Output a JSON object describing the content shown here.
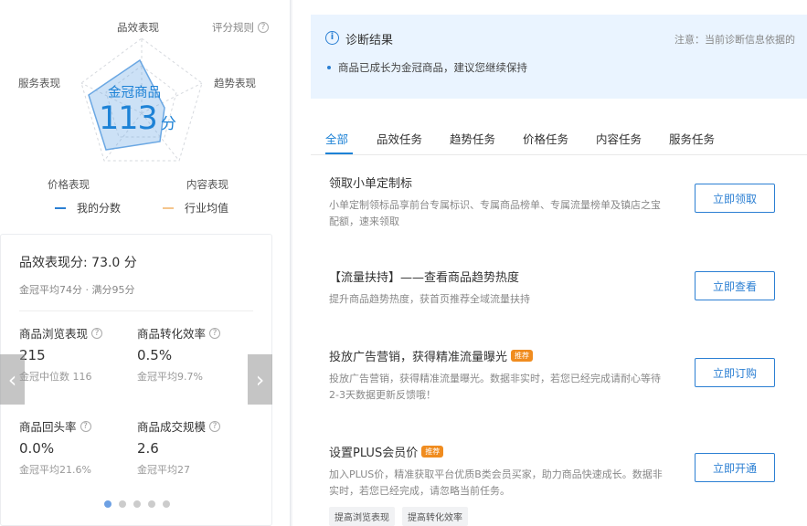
{
  "radar": {
    "axes": [
      "品效表现",
      "趋势表现",
      "内容表现",
      "价格表现",
      "服务表现"
    ],
    "score_rule": "评分规则",
    "center_title": "金冠商品",
    "score": "113",
    "score_unit": "分",
    "legend": [
      {
        "label": "我的分数",
        "color": "#2b7fd3"
      },
      {
        "label": "行业均值",
        "color": "#f5c58c"
      }
    ]
  },
  "perf_card": {
    "title": "品效表现分: 73.0 分",
    "subtitle": "金冠平均74分 · 满分95分",
    "metrics": [
      {
        "name": "商品浏览表现",
        "value": "215",
        "sub": "金冠中位数 116"
      },
      {
        "name": "商品转化效率",
        "value": "0.5%",
        "sub": "金冠平均9.7%"
      },
      {
        "name": "商品回头率",
        "value": "0.0%",
        "sub": "金冠平均21.6%"
      },
      {
        "name": "商品成交规模",
        "value": "2.6",
        "sub": "金冠平均27"
      }
    ],
    "prev_arrow": "‹",
    "next_arrow": "›"
  },
  "diagnosis": {
    "title": "诊断结果",
    "note": "注意：当前诊断信息依据的",
    "bullet": "商品已成长为金冠商品，建议您继续保持"
  },
  "tabs": [
    "全部",
    "品效任务",
    "趋势任务",
    "价格任务",
    "内容任务",
    "服务任务"
  ],
  "tasks": [
    {
      "title": "领取小单定制标",
      "badge": "",
      "desc": "小单定制领标品享前台专属标识、专属商品榜单、专属流量榜单及镇店之宝配额，速来领取",
      "button": "立即领取",
      "tags": []
    },
    {
      "title": "【流量扶持】——查看商品趋势热度",
      "badge": "",
      "desc": "提升商品趋势热度，获首页推荐全域流量扶持",
      "button": "立即查看",
      "tags": []
    },
    {
      "title": "投放广告营销，获得精准流量曝光",
      "badge": "推荐",
      "desc": "投放广告营销，获得精准流量曝光。数据非实时，若您已经完成请耐心等待2-3天数据更新反馈哦！",
      "button": "立即订购",
      "tags": []
    },
    {
      "title": "设置PLUS会员价",
      "badge": "推荐",
      "desc": "加入PLUS价，精准获取平台优质B类会员买家，助力商品快速成长。数据非实时，若您已经完成，请忽略当前任务。",
      "button": "立即开通",
      "tags": [
        "提高浏览表现",
        "提高转化效率"
      ]
    }
  ]
}
